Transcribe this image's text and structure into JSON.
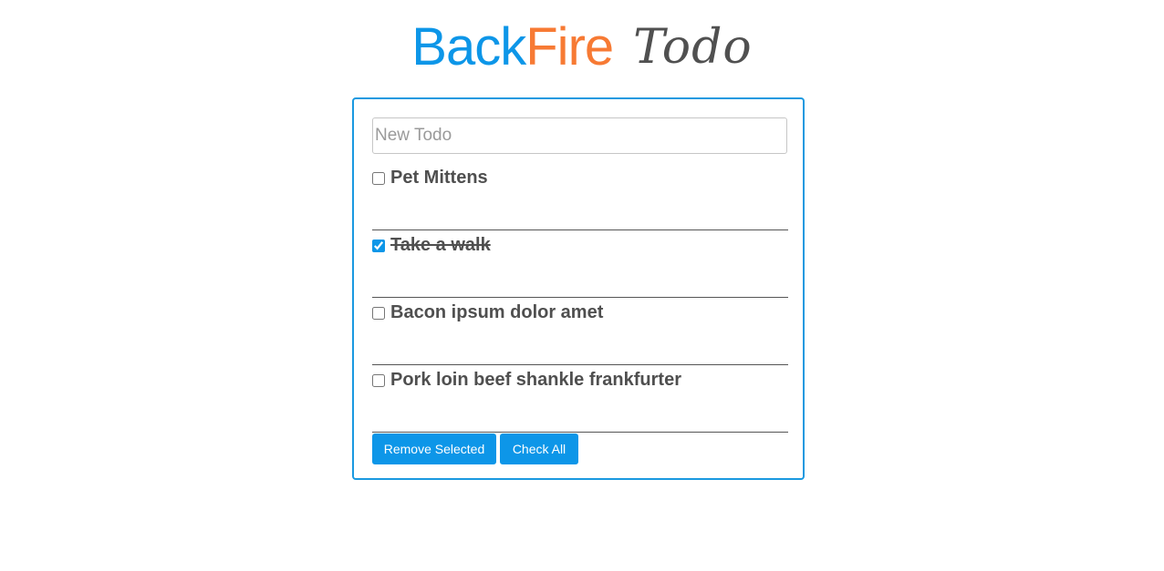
{
  "header": {
    "logo_back": "Back",
    "logo_fire": "Fire",
    "logo_todo": "Todo"
  },
  "new_todo": {
    "placeholder": "New Todo",
    "value": ""
  },
  "todos": [
    {
      "text": "Pet Mittens",
      "done": false
    },
    {
      "text": "Take a walk",
      "done": true
    },
    {
      "text": "Bacon ipsum dolor amet",
      "done": false
    },
    {
      "text": "Pork loin beef shankle frankfurter",
      "done": false
    }
  ],
  "actions": {
    "remove_selected_label": "Remove Selected",
    "check_all_label": "Check All"
  },
  "colors": {
    "accent_blue": "#0d96e8",
    "brand_orange": "#f77a34",
    "panel_border": "#1a99e0",
    "todo_text": "#4f4f4f"
  }
}
